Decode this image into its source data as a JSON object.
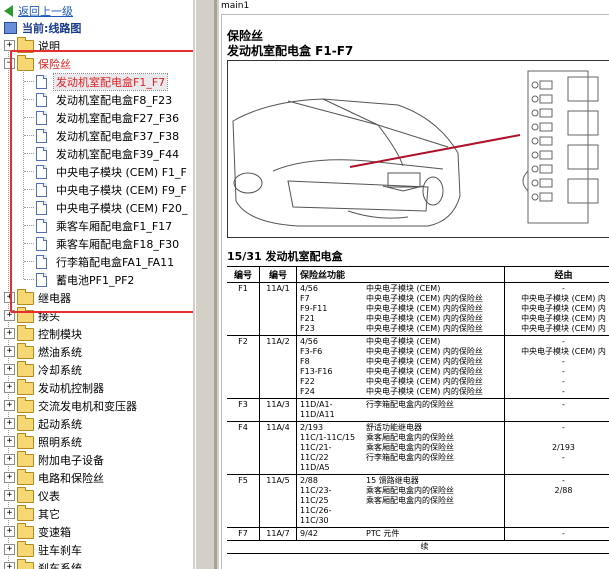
{
  "nav": {
    "back_label": "返回上一级",
    "current_label": "当前:线路图"
  },
  "tree": {
    "items": [
      {
        "label": "说明",
        "expanded": false
      },
      {
        "label": "保险丝",
        "expanded": true,
        "highlighted": true
      },
      {
        "label": "继电器",
        "expanded": false
      },
      {
        "label": "接头",
        "expanded": false
      },
      {
        "label": "控制模块",
        "expanded": false
      },
      {
        "label": "燃油系统",
        "expanded": false
      },
      {
        "label": "冷却系统",
        "expanded": false
      },
      {
        "label": "发动机控制器",
        "expanded": false
      },
      {
        "label": "交流发电机和变压器",
        "expanded": false
      },
      {
        "label": "起动系统",
        "expanded": false
      },
      {
        "label": "照明系统",
        "expanded": false
      },
      {
        "label": "附加电子设备",
        "expanded": false
      },
      {
        "label": "电路和保险丝",
        "expanded": false
      },
      {
        "label": "仪表",
        "expanded": false
      },
      {
        "label": "其它",
        "expanded": false
      },
      {
        "label": "变速箱",
        "expanded": false
      },
      {
        "label": "驻车刹车",
        "expanded": false
      },
      {
        "label": "刹车系统",
        "expanded": false
      }
    ],
    "fuse_children": [
      {
        "label": "发动机室配电盒F1_F7",
        "selected": true
      },
      {
        "label": "发动机室配电盒F8_F23"
      },
      {
        "label": "发动机室配电盒F27_F36"
      },
      {
        "label": "发动机室配电盒F37_F38"
      },
      {
        "label": "发动机室配电盒F39_F44"
      },
      {
        "label": "中央电子模块 (CEM) F1_F"
      },
      {
        "label": "中央电子模块 (CEM) F9_F"
      },
      {
        "label": "中央电子模块 (CEM) F20_"
      },
      {
        "label": "乘客车厢配电盒F1_F17"
      },
      {
        "label": "乘客车厢配电盒F18_F30"
      },
      {
        "label": "行李箱配电盒FA1_FA11"
      },
      {
        "label": "蓄电池PF1_PF2"
      }
    ]
  },
  "doc": {
    "tab_title": "main1",
    "heading1": "保险丝",
    "heading2": "发动机室配电盒 F1-F7",
    "section_title": "15/31 发动机室配电盒",
    "columns": [
      "编号",
      "编号",
      "保险丝功能",
      "",
      "经由"
    ],
    "rows": [
      {
        "no": "F1",
        "code": "11A/1",
        "subs": [
          "4/56",
          "F7",
          "F9-F11",
          "F21",
          "F23"
        ],
        "funcs": [
          "中央电子模块 (CEM)",
          "中央电子模块 (CEM) 内的保险丝",
          "中央电子模块 (CEM) 内的保险丝",
          "中央电子模块 (CEM) 内的保险丝",
          "中央电子模块 (CEM) 内的保险丝"
        ],
        "via": [
          "-",
          "中央电子模块 (CEM) 内",
          "中央电子模块 (CEM) 内",
          "中央电子模块 (CEM) 内",
          "中央电子模块 (CEM) 内"
        ]
      },
      {
        "no": "F2",
        "code": "11A/2",
        "subs": [
          "4/56",
          "F3-F6",
          "F8",
          "F13-F16",
          "F22",
          "F24"
        ],
        "funcs": [
          "中央电子模块 (CEM)",
          "中央电子模块 (CEM) 内的保险丝",
          "中央电子模块 (CEM) 内的保险丝",
          "中央电子模块 (CEM) 内的保险丝",
          "中央电子模块 (CEM) 内的保险丝",
          "中央电子模块 (CEM) 内的保险丝"
        ],
        "via": [
          "-",
          "中央电子模块 (CEM) 内",
          "-",
          "-",
          "-",
          "-"
        ]
      },
      {
        "no": "F3",
        "code": "11A/3",
        "subs": [
          "11D/A1-11D/A11"
        ],
        "funcs": [
          "行李箱配电盒内的保险丝"
        ],
        "via": [
          "-"
        ]
      },
      {
        "no": "F4",
        "code": "11A/4",
        "subs": [
          "2/193",
          "11C/1-11C/15",
          "11C/21-11C/22",
          "11D/A5"
        ],
        "funcs": [
          "舒适功能继电器",
          "乘客厢配电盒内的保险丝",
          "乘客厢配电盒内的保险丝",
          "行李箱配电盒内的保险丝"
        ],
        "via": [
          "-",
          "",
          "2/193",
          "-"
        ]
      },
      {
        "no": "F5",
        "code": "11A/5",
        "subs": [
          "2/88",
          "11C/23-11C/25",
          "11C/26-11C/30"
        ],
        "funcs": [
          "15 馈路继电器",
          "乘客厢配电盒内的保险丝",
          "乘客厢配电盒内的保险丝"
        ],
        "via": [
          "-",
          "2/88",
          ""
        ]
      },
      {
        "no": "F7",
        "code": "11A/7",
        "subs": [
          "9/42"
        ],
        "funcs": [
          "PTC 元件"
        ],
        "via": [
          "-"
        ]
      }
    ],
    "continued": "续"
  },
  "colors": {
    "highlight_box": "#e63030",
    "selected_text": "#e02020",
    "link": "#1a57b8"
  }
}
